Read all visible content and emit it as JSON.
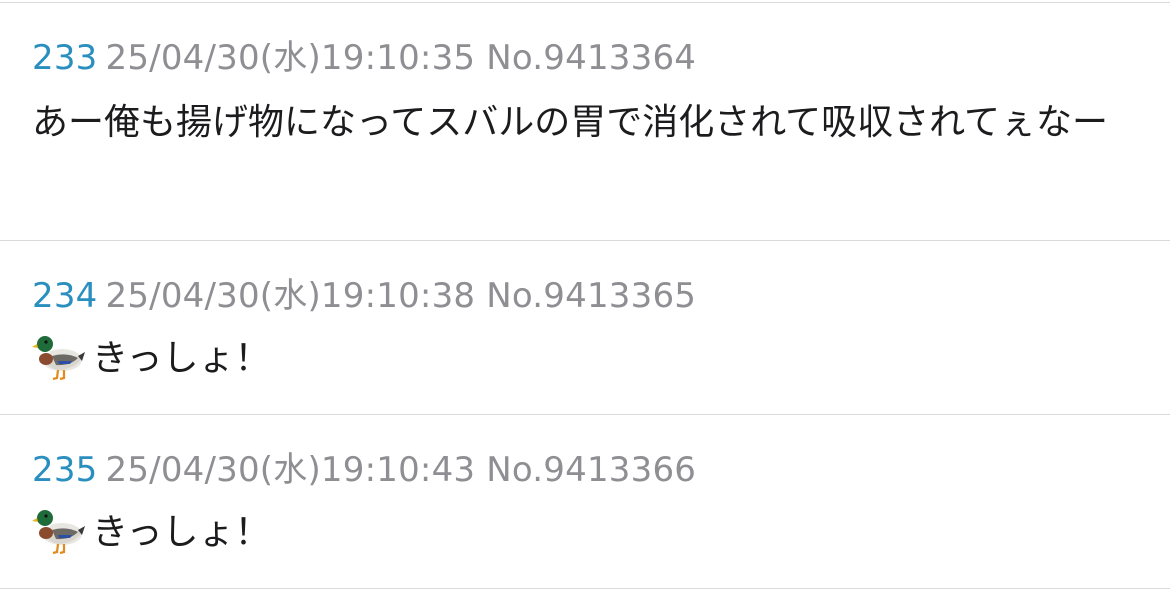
{
  "posts": [
    {
      "number": "233",
      "meta": "25/04/30(水)19:10:35 No.9413364",
      "body": "あー俺も揚げ物になってスバルの胃で消化されて吸収されてぇなー",
      "icon": null
    },
    {
      "number": "234",
      "meta": "25/04/30(水)19:10:38 No.9413365",
      "body": "きっしょ！",
      "icon": "duck-emoji"
    },
    {
      "number": "235",
      "meta": "25/04/30(水)19:10:43 No.9413366",
      "body": "きっしょ！",
      "icon": "duck-emoji"
    }
  ],
  "colors": {
    "post_number": "#2a8fbe",
    "meta": "#8e8e93",
    "body": "#1c1c1e",
    "divider": "#d9d9de",
    "background": "#ffffff"
  }
}
